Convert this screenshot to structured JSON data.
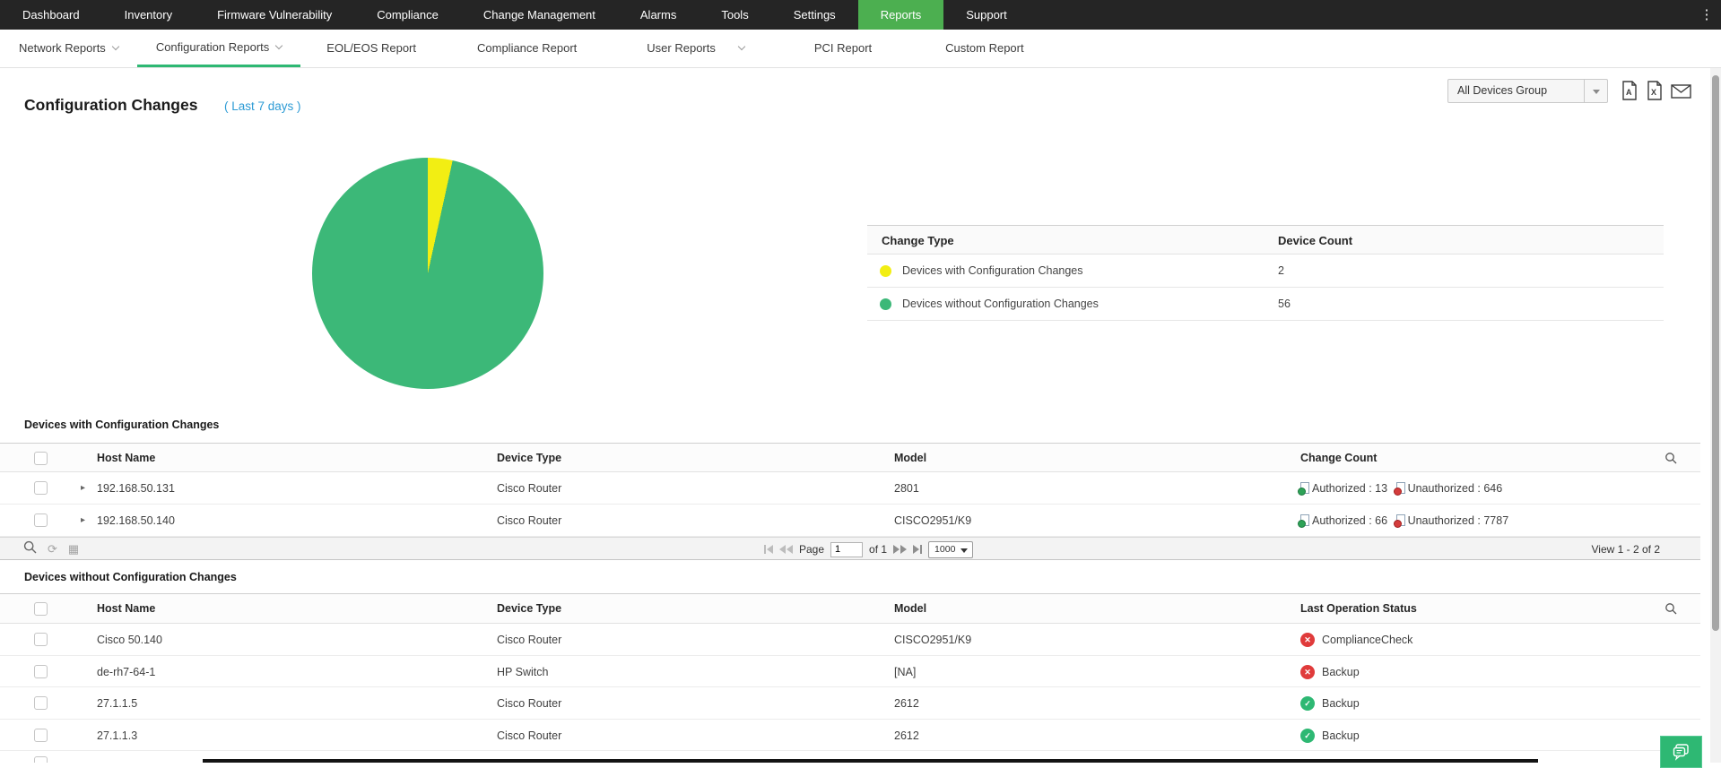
{
  "top_nav": {
    "items": [
      "Dashboard",
      "Inventory",
      "Firmware Vulnerability",
      "Compliance",
      "Change Management",
      "Alarms",
      "Tools",
      "Settings",
      "Reports",
      "Support"
    ],
    "active": "Reports"
  },
  "sub_nav": {
    "items": [
      "Network Reports",
      "Configuration Reports",
      "EOL/EOS Report",
      "Compliance Report",
      "User Reports",
      "PCI Report",
      "Custom Report"
    ],
    "active": "Configuration Reports"
  },
  "header": {
    "title": "Configuration Changes",
    "period": "( Last 7 days )",
    "group_selector": "All Devices Group"
  },
  "chart_data": {
    "type": "pie",
    "labels": [
      "Devices with Configuration Changes",
      "Devices without Configuration Changes"
    ],
    "values": [
      2,
      56
    ],
    "colors": [
      "#f2ee13",
      "#3cb878"
    ],
    "legend_position": "right-table"
  },
  "legend_table": {
    "col_type": "Change Type",
    "col_count": "Device Count",
    "rows": [
      {
        "label": "Devices with Configuration Changes",
        "count": "2",
        "color": "#f2ee13"
      },
      {
        "label": "Devices without Configuration Changes",
        "count": "56",
        "color": "#3cb878"
      }
    ]
  },
  "table_with_changes": {
    "title": "Devices with Configuration Changes",
    "columns": {
      "host": "Host Name",
      "type": "Device Type",
      "model": "Model",
      "count": "Change Count"
    },
    "rows": [
      {
        "host": "192.168.50.131",
        "type": "Cisco Router",
        "model": "2801",
        "authorized": "Authorized : 13",
        "unauthorized": "Unauthorized : 646"
      },
      {
        "host": "192.168.50.140",
        "type": "Cisco Router",
        "model": "CISCO2951/K9",
        "authorized": "Authorized : 66",
        "unauthorized": "Unauthorized : 7787"
      }
    ],
    "pager": {
      "page_label": "Page",
      "page_value": "1",
      "of_label": "of 1",
      "page_size": "1000",
      "view_label": "View 1 - 2 of 2"
    }
  },
  "table_without_changes": {
    "title": "Devices without Configuration Changes",
    "columns": {
      "host": "Host Name",
      "type": "Device Type",
      "model": "Model",
      "status": "Last Operation Status"
    },
    "rows": [
      {
        "host": "Cisco 50.140",
        "type": "Cisco Router",
        "model": "CISCO2951/K9",
        "status": "ComplianceCheck",
        "status_ok": false
      },
      {
        "host": "de-rh7-64-1",
        "type": "HP Switch",
        "model": "[NA]",
        "status": "Backup",
        "status_ok": false
      },
      {
        "host": "27.1.1.5",
        "type": "Cisco Router",
        "model": "2612",
        "status": "Backup",
        "status_ok": true
      },
      {
        "host": "27.1.1.3",
        "type": "Cisco Router",
        "model": "2612",
        "status": "Backup",
        "status_ok": true
      }
    ]
  },
  "colors": {
    "topnav_bg": "#252525",
    "active_tab_green": "#4caf50",
    "underline_green": "#2eb873",
    "pie_green": "#3cb878",
    "pie_yellow": "#f2ee13",
    "link_blue": "#2d9bd5",
    "status_red": "#e03b3b",
    "status_green": "#2eb873"
  }
}
